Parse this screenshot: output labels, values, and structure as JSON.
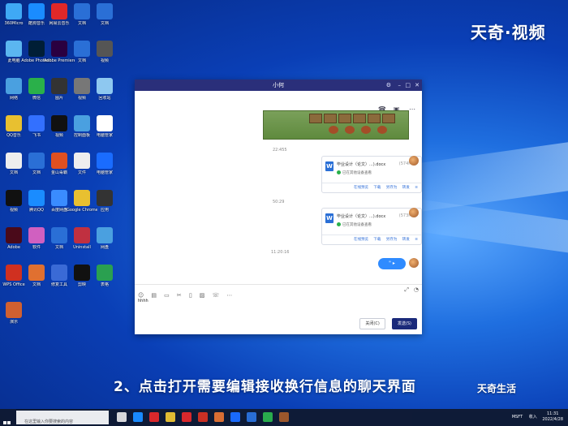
{
  "watermark_top": "天奇·视频",
  "caption": "2、点击打开需要编辑接收换行信息的聊天界面",
  "brand": "天奇生活",
  "colors": {
    "desktop": "#0a3fb6",
    "titlebar": "#2a2f7a",
    "send": "#1b2a7a",
    "link": "#2f6ed8"
  },
  "desktop_icons": [
    {
      "label": "360Micro",
      "color": "#3fa9f5"
    },
    {
      "label": "酷狗音乐",
      "color": "#1a8cff"
    },
    {
      "label": "网易云音乐",
      "color": "#e02828"
    },
    {
      "label": "文档",
      "color": "#2a6fd6"
    },
    {
      "label": "文档",
      "color": "#2a6fd6"
    },
    {
      "label": "此电脑",
      "color": "#5bb6f0"
    },
    {
      "label": "Adobe Photosh",
      "color": "#001e36"
    },
    {
      "label": "Adobe Premiere",
      "color": "#2a0040"
    },
    {
      "label": "文档",
      "color": "#2a6fd6"
    },
    {
      "label": "视频",
      "color": "#555555"
    },
    {
      "label": "网络",
      "color": "#4aa0e0"
    },
    {
      "label": "微信",
      "color": "#2ab04a"
    },
    {
      "label": "图片",
      "color": "#333333"
    },
    {
      "label": "视频",
      "color": "#777777"
    },
    {
      "label": "回收站",
      "color": "#8ec8f0"
    },
    {
      "label": "QQ音乐",
      "color": "#e8c030"
    },
    {
      "label": "飞书",
      "color": "#3370ff"
    },
    {
      "label": "视频",
      "color": "#111111"
    },
    {
      "label": "控制面板",
      "color": "#4aa0e0"
    },
    {
      "label": "电脑管家",
      "color": "#ffffff"
    },
    {
      "label": "文档",
      "color": "#eeeeee"
    },
    {
      "label": "文档",
      "color": "#2a6fd6"
    },
    {
      "label": "金山毒霸",
      "color": "#e05020"
    },
    {
      "label": "文件",
      "color": "#eeeeee"
    },
    {
      "label": "电脑管家",
      "color": "#1a6cff"
    },
    {
      "label": "视频",
      "color": "#111111"
    },
    {
      "label": "腾讯QQ",
      "color": "#1a8cff"
    },
    {
      "label": "百度网盘",
      "color": "#3a8cff"
    },
    {
      "label": "Google Chrome",
      "color": "#e8c030"
    },
    {
      "label": "应用",
      "color": "#333333"
    },
    {
      "label": "Adobe",
      "color": "#4a0a1a"
    },
    {
      "label": "软件",
      "color": "#d060c0"
    },
    {
      "label": "文档",
      "color": "#2a6fd6"
    },
    {
      "label": "Uninstall",
      "color": "#c03040"
    },
    {
      "label": "网盘",
      "color": "#4aa0e0"
    },
    {
      "label": "WPS Office",
      "color": "#d03020"
    },
    {
      "label": "文档",
      "color": "#e07030"
    },
    {
      "label": "修复工具",
      "color": "#3a6ad6"
    },
    {
      "label": "剪映",
      "color": "#111111"
    },
    {
      "label": "表格",
      "color": "#2aa050"
    },
    {
      "label": "演示",
      "color": "#d06030"
    }
  ],
  "chat": {
    "title": "小何",
    "timestamps": [
      "22:455",
      "50:29",
      "11:20:16"
    ],
    "files": [
      {
        "name": "毕业设计（论文）...).docx",
        "size": "(574MB)",
        "status": "已在其他设备查看",
        "actions": [
          "在线预览",
          "下载",
          "另存为",
          "转发"
        ]
      },
      {
        "name": "毕业设计（论文）...).docx",
        "size": "(573MB)",
        "status": "已在其他设备查看",
        "actions": [
          "在线预览",
          "下载",
          "另存为",
          "转发"
        ]
      }
    ],
    "voice_label": "\" ▸",
    "typed_text": "hhhh",
    "buttons": {
      "close": "关闭(C)",
      "send": "发送(S)"
    }
  },
  "taskbar": {
    "search_placeholder": "在这里输入你要搜索的内容",
    "tray_stock": "MSFT",
    "tray_lang": "收入",
    "time": "11:31",
    "date": "2022/4/28"
  }
}
